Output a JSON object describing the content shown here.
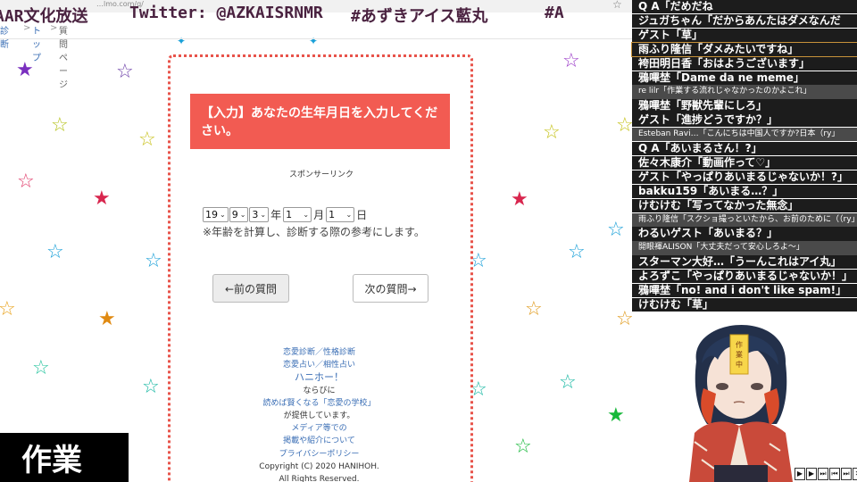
{
  "browser": {
    "url_fragment": "…lmo.com/q/",
    "marquee": [
      {
        "text": "AAR文化放送"
      },
      {
        "text": "Twitter: @AZKAISRNMR"
      },
      {
        "text": "#あずきアイス藍丸"
      },
      {
        "text": "#A"
      }
    ],
    "breadcrumb": [
      {
        "label": "診断"
      },
      {
        "label": "トップ"
      },
      {
        "label": "質問ページ"
      }
    ]
  },
  "question": {
    "title": "【入力】あなたの生年月日を入力してください。",
    "sponsor_label": "スポンサーリンク",
    "year_value": "19",
    "year2_value": "9",
    "year3_value": "3",
    "year_unit": "年",
    "month_value": "1",
    "month_unit": "月",
    "day_value": "1",
    "day_unit": "日",
    "note": "※年齢を計算し、診断する際の参考にします。",
    "prev_label": "←前の質問",
    "next_label": "次の質問→"
  },
  "footer": {
    "link1": "恋愛診断／性格診断",
    "link2": "恋愛占い／相性占い",
    "link3": "ハニホー！",
    "text1": "ならびに",
    "link4": "読めば賢くなる「恋愛の学校」",
    "text2": "が提供しています。",
    "link5": "メディア等での",
    "link6": "掲載や紹介について",
    "link7": "プライバシーポリシー",
    "copyright": "Copyright (C) 2020 HANIHOH.",
    "rights": "All Rights Reserved."
  },
  "badge": {
    "label": "作業"
  },
  "chat": [
    {
      "text": "Q A「だめだね",
      "style": "dark"
    },
    {
      "text": "ジュガちゃん「だからあんたはダメなんだ",
      "style": "dark"
    },
    {
      "text": "ゲスト「草」",
      "style": "dark"
    },
    {
      "text": "雨ふり隆信「ダメみたいですね」",
      "style": "hl"
    },
    {
      "text": "袴田明日香「おはようございます」",
      "style": "dark"
    },
    {
      "text": "鴉嗶埜「Dame da ne meme」",
      "style": "dark"
    },
    {
      "text": "re lilr「作業する流れじゃなかったのかよこれ」",
      "style": "small"
    },
    {
      "text": "鴉嗶埜「野獣先輩にしろ」",
      "style": "dark"
    },
    {
      "text": "ゲスト「進捗どうですか？」",
      "style": "dark"
    },
    {
      "text": "Esteban Ravi…「こんにちは中国人ですか?日本（ry」",
      "style": "small"
    },
    {
      "text": "Q A「あいまるさん！?」",
      "style": "dark"
    },
    {
      "text": "佐々木康介「動画作って♡」",
      "style": "dark"
    },
    {
      "text": "ゲスト「やっぱりあいまるじゃないか！?」",
      "style": "dark"
    },
    {
      "text": "bakku159「あいまる…？」",
      "style": "dark"
    },
    {
      "text": "けむけむ「写ってなかった無念」",
      "style": "dark"
    },
    {
      "text": "雨ふり隆信「スクショ撮っといたから、お前のために（（ry」",
      "style": "small"
    },
    {
      "text": "わるいゲスト「あいまる？」",
      "style": "dark"
    },
    {
      "text": "開眼褌ALISON「大丈夫だって安心しろよ～」",
      "style": "small"
    },
    {
      "text": "スターマン大好…「うーんこれはアイ丸」",
      "style": "dark"
    },
    {
      "text": "よろずこ「やっぱりあいまるじゃないか！」",
      "style": "dark"
    },
    {
      "text": "鴉嗶埜「no! and i don't like spam!」",
      "style": "dark"
    },
    {
      "text": "けむけむ「草」",
      "style": "dark"
    }
  ],
  "avatar_tag": "作業中",
  "controls": [
    "▌▶",
    "▶",
    "▶▌",
    "◀▌",
    "▶▌",
    "✕"
  ],
  "colors": {
    "accent": "#f25b52",
    "link": "#3a6eb5",
    "chat_bg": "#1c1c1c"
  }
}
